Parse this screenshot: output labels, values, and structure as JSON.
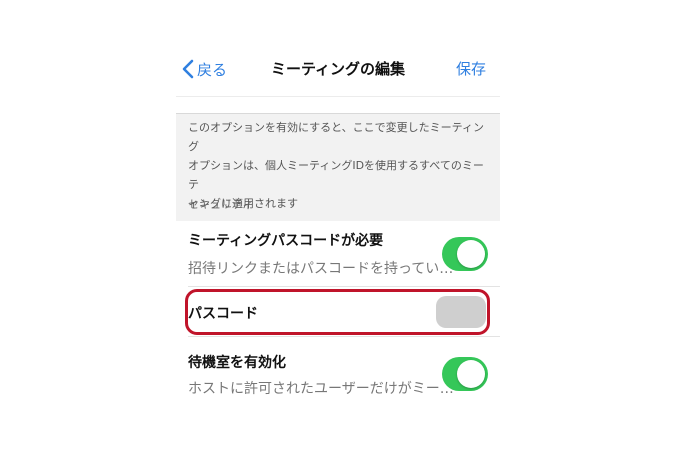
{
  "navbar": {
    "back_label": "戻る",
    "title": "ミーティングの編集",
    "save_label": "保存"
  },
  "description": {
    "line1": "このオプションを有効にすると、ここで変更したミーティング",
    "line2": "オプションは、個人ミーティングIDを使用するすべてのミーテ",
    "line3": "ィングに適用されます"
  },
  "section": {
    "header": "セキュリティ"
  },
  "settings": [
    {
      "title": "ミーティングパスコードが必要",
      "subtitle": "招待リンクまたはパスコードを持ってい…",
      "toggle": "on"
    },
    {
      "title": "パスコード",
      "toggle": "off"
    },
    {
      "title": "待機室を有効化",
      "subtitle": "ホストに許可されたユーザーだけがミー…",
      "toggle": "on"
    }
  ],
  "colors": {
    "accent": "#2f7fe0",
    "toggle_on": "#35c759",
    "toggle_off": "#cfcfcf",
    "highlight": "#c0142a"
  },
  "icons": {
    "back": "chevron-left-icon"
  }
}
